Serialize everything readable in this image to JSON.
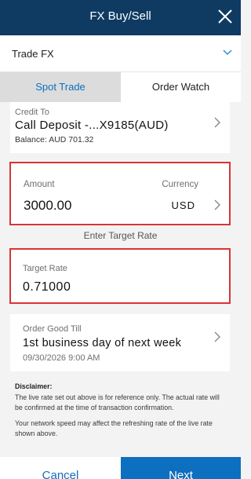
{
  "header": {
    "title": "FX Buy/Sell",
    "close_icon": "close-icon"
  },
  "trade_select": {
    "value": "Trade FX",
    "icon": "chevron-down-icon"
  },
  "tabs": [
    {
      "label": "Spot Trade",
      "active": true
    },
    {
      "label": "Order Watch",
      "active": false
    }
  ],
  "credit": {
    "label": "Credit To",
    "account": "Call Deposit -...X9185(AUD)",
    "balance": "Balance: AUD 701.32"
  },
  "amount": {
    "label": "Amount",
    "value": "3000.00",
    "currency_label": "Currency",
    "currency_value": "USD"
  },
  "enter_target_rate": "Enter Target Rate",
  "target_rate": {
    "label": "Target Rate",
    "value": "0.71000"
  },
  "order_good_till": {
    "label": "Order Good Till",
    "value": "1st business day of next week",
    "date": "09/30/2026 9:00 AM"
  },
  "disclaimer": {
    "heading": "Disclaimer:",
    "p1": "The live rate set out above is for reference only. The actual rate will be confirmed at the time of transaction confirmation.",
    "p2": "Your network speed may affect the refreshing rate of the live rate shown above."
  },
  "footer": {
    "cancel": "Cancel",
    "next": "Next"
  },
  "colors": {
    "header": "#0f3b63",
    "accent": "#0d6fbf",
    "highlight": "#d93434"
  }
}
